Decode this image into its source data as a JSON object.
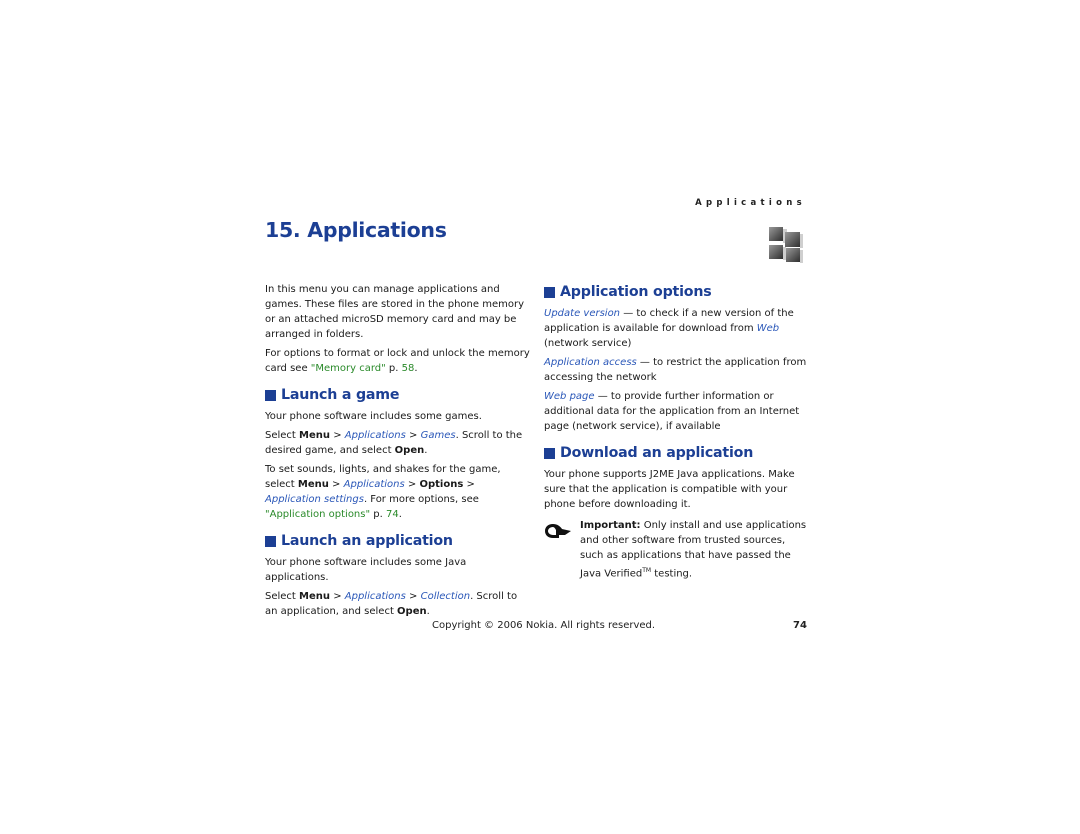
{
  "running_head": "Applications",
  "chapter_title": "15. Applications",
  "icons": {
    "chapter": "applications-cube-icon",
    "note": "important-hand-icon",
    "section_bullet": "blue-square-icon"
  },
  "colors": {
    "heading": "#1c3f94",
    "italic_term": "#2a57b8",
    "cross_ref": "#2a8a2a"
  },
  "intro": {
    "p1": "In this menu you can manage applications and games. These files are stored in the phone memory or an attached microSD memory card and may be arranged in folders.",
    "p2_pre": "For options to format or lock and unlock the memory card see ",
    "p2_link": "\"Memory card\"",
    "p2_mid": " p. ",
    "p2_page": "58",
    "p2_post": "."
  },
  "launch_game": {
    "title": "Launch a game",
    "p1": "Your phone software includes some games.",
    "p2": {
      "select": "Select ",
      "menu": "Menu",
      "gt1": " > ",
      "apps": "Applications",
      "gt2": " > ",
      "games": "Games",
      "rest": ". Scroll to the desired game, and select ",
      "open": "Open",
      "end": "."
    },
    "p3": {
      "pre": "To set sounds, lights, and shakes for the game, select ",
      "menu": "Menu",
      "gt1": " > ",
      "apps": "Applications",
      "gt2": " > ",
      "options": "Options",
      "gt3": " > ",
      "settings": "Application settings",
      "mid": ". For more options, see ",
      "link": "\"Application options\"",
      "pg_pre": " p. ",
      "page": "74",
      "end": "."
    }
  },
  "launch_app": {
    "title": "Launch an application",
    "p1": "Your phone software includes some Java applications.",
    "p2": {
      "select": "Select ",
      "menu": "Menu",
      "gt1": " > ",
      "apps": "Applications",
      "gt2": " > ",
      "collection": "Collection",
      "rest": ". Scroll to an application, and select ",
      "open": "Open",
      "end": "."
    }
  },
  "app_options": {
    "title": "Application options",
    "items": [
      {
        "term": "Update version",
        "desc_pre": " — to check if a new version of the application is available for download from ",
        "term2": "Web",
        "desc_post": " (network service)"
      },
      {
        "term": "Application access",
        "desc_pre": " — to restrict the application from accessing the network",
        "term2": "",
        "desc_post": ""
      },
      {
        "term": "Web page",
        "desc_pre": " — to provide further information or additional data for the application from an Internet page (network service), if available",
        "term2": "",
        "desc_post": ""
      }
    ]
  },
  "download_app": {
    "title": "Download an application",
    "p1": "Your phone supports J2ME Java applications. Make sure that the application is compatible with your phone before downloading it.",
    "note_label": "Important:",
    "note_text": " Only install and use applications and other software from trusted sources, such as applications that have passed the Java Verified",
    "note_tm": "TM",
    "note_end": " testing."
  },
  "footer": {
    "copyright": "Copyright © 2006 Nokia. All rights reserved.",
    "page_number": "74"
  }
}
